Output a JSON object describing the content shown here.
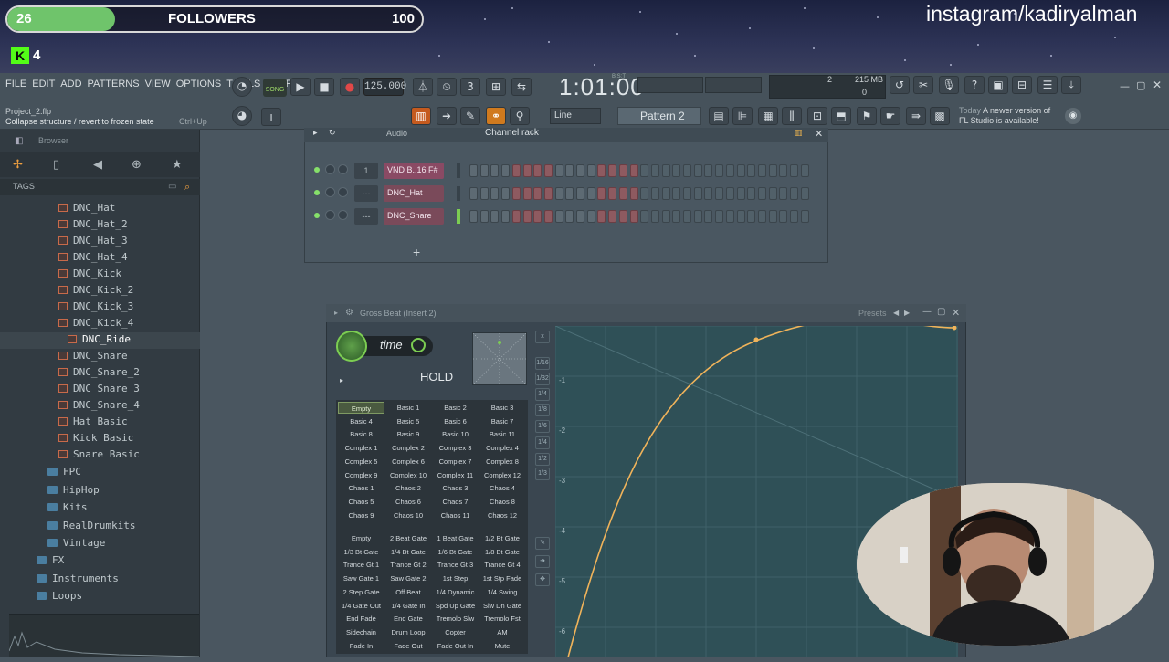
{
  "stream": {
    "followers_count": "26",
    "followers_label": "FOLLOWERS",
    "followers_goal": "100",
    "followers_progress": 0.26,
    "kick_count": "4",
    "instagram": "instagram/kadiryalman"
  },
  "toolbar": {
    "menu": [
      "FILE",
      "EDIT",
      "ADD",
      "PATTERNS",
      "VIEW",
      "OPTIONS",
      "TOOLS",
      "HELP"
    ],
    "song_mode": "SONG",
    "tempo": "125.000",
    "time": "1:01:00",
    "time_unit": "B:S:T",
    "memory": "215 MB",
    "voices": "2",
    "cpu": "0",
    "project": "Project_2.flp",
    "hint": "Collapse structure / revert to frozen state",
    "hint_key": "Ctrl+Up",
    "snap": "Line",
    "pattern": "Pattern 2",
    "news_day": "Today",
    "news_text": "A newer version of",
    "news_text2": "FL Studio is available!"
  },
  "browser": {
    "title": "Browser",
    "tags": "TAGS",
    "selected": "DNC_Ride",
    "files": [
      "DNC_Hat",
      "DNC_Hat_2",
      "DNC_Hat_3",
      "DNC_Hat_4",
      "DNC_Kick",
      "DNC_Kick_2",
      "DNC_Kick_3",
      "DNC_Kick_4",
      "DNC_Ride",
      "DNC_Snare",
      "DNC_Snare_2",
      "DNC_Snare_3",
      "DNC_Snare_4",
      "Hat Basic",
      "Kick Basic",
      "Snare Basic"
    ],
    "folders": [
      "FPC",
      "HipHop",
      "Kits",
      "RealDrumkits",
      "Vintage"
    ],
    "root_folders": [
      "FX",
      "Instruments",
      "Loops"
    ]
  },
  "channel_rack": {
    "title": "Channel rack",
    "audio": "Audio",
    "channels": [
      {
        "num": "1",
        "name": "VND B..16 F#",
        "color": "#8a4a64"
      },
      {
        "num": "---",
        "name": "DNC_Hat",
        "color": "#7a4a5a"
      },
      {
        "num": "---",
        "name": "DNC_Snare",
        "color": "#7a4a5a"
      }
    ]
  },
  "gross_beat": {
    "title": "Gross Beat (Insert 2)",
    "presets_label": "Presets",
    "mode": "time",
    "hold": "HOLD",
    "time_presets": [
      "Empty",
      "Basic 1",
      "Basic 2",
      "Basic 3",
      "Basic 4",
      "Basic 5",
      "Basic 6",
      "Basic 7",
      "Basic 8",
      "Basic 9",
      "Basic 10",
      "Basic 11",
      "Complex 1",
      "Complex 2",
      "Complex 3",
      "Complex 4",
      "Complex 5",
      "Complex 6",
      "Complex 7",
      "Complex 8",
      "Complex 9",
      "Complex 10",
      "Complex 11",
      "Complex 12",
      "Chaos 1",
      "Chaos 2",
      "Chaos 3",
      "Chaos 4",
      "Chaos 5",
      "Chaos 6",
      "Chaos 7",
      "Chaos 8",
      "Chaos 9",
      "Chaos 10",
      "Chaos 11",
      "Chaos 12"
    ],
    "volume_presets": [
      "Empty",
      "2 Beat Gate",
      "1 Beat Gate",
      "1/2 Bt Gate",
      "1/3 Bt Gate",
      "1/4 Bt Gate",
      "1/6 Bt Gate",
      "1/8 Bt Gate",
      "Trance Gt 1",
      "Trance Gt 2",
      "Trance Gt 3",
      "Trance Gt 4",
      "Saw Gate 1",
      "Saw Gate 2",
      "1st Step",
      "1st Stp Fade",
      "2 Step Gate",
      "Off Beat",
      "1/4 Dynamic",
      "1/4 Swing",
      "1/4 Gate Out",
      "1/4 Gate In",
      "Spd Up Gate",
      "Slw Dn Gate",
      "End Fade",
      "End Gate",
      "Tremolo Slw",
      "Tremolo Fst",
      "Sidechain",
      "Drum Loop",
      "Copter",
      "AM",
      "Fade In",
      "Fade Out",
      "Fade Out In",
      "Mute"
    ],
    "side_labels": [
      "x",
      "1/16",
      "1/32",
      "1/4",
      "1/8",
      "1/6",
      "1/4",
      "1/2",
      "1/3"
    ],
    "y_labels": [
      "-1",
      "-2",
      "-3",
      "-4",
      "-5",
      "-6"
    ]
  },
  "colors": {
    "accent": "#7ccd52",
    "kick": "#53fc18",
    "curve": "#f0b35a"
  }
}
